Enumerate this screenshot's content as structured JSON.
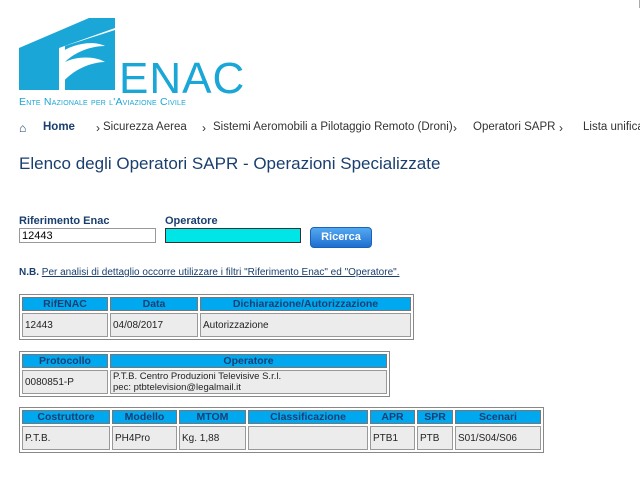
{
  "logo": {
    "word": "ENAC",
    "subtitle": "Ente Nazionale per l'Aviazione Civile"
  },
  "breadcrumb": {
    "items": [
      "Home",
      "Sicurezza Aerea",
      "Sistemi Aeromobili a Pilotaggio Remoto (Droni)",
      "Operatori SAPR",
      "Lista unifica"
    ]
  },
  "page": {
    "title": "Elenco degli Operatori SAPR - Operazioni Specializzate"
  },
  "search": {
    "rif_label": "Riferimento Enac",
    "rif_value": "12443",
    "op_label": "Operatore",
    "op_value": "",
    "button": "Ricerca"
  },
  "note": {
    "prefix": "N.B.",
    "text": "Per analisi di dettaglio occorre utilizzare i filtri \"Riferimento Enac\" ed \"Operatore\"."
  },
  "table1": {
    "headers": [
      "RifENAC",
      "Data",
      "Dichiarazione/Autorizzazione"
    ],
    "row": [
      "12443",
      "04/08/2017",
      "Autorizzazione"
    ]
  },
  "table2": {
    "headers": [
      "Protocollo",
      "Operatore"
    ],
    "row": [
      "0080851-P",
      "P.T.B. Centro Produzioni Televisive S.r.l.",
      "pec: ptbtelevision@legalmail.it"
    ]
  },
  "table3": {
    "headers": [
      "Costruttore",
      "Modello",
      "MTOM",
      "Classificazione",
      "APR",
      "SPR",
      "Scenari"
    ],
    "row": [
      "P.T.B.",
      "PH4Pro",
      "Kg. 1,88",
      "",
      "PTB1",
      "PTB",
      "S01/S04/S06"
    ]
  },
  "colors": {
    "brand": "#1aa6d6",
    "header_bg": "#00a8f0",
    "text_dark": "#1a3f6f",
    "input_highlight": "#00e5e5"
  }
}
